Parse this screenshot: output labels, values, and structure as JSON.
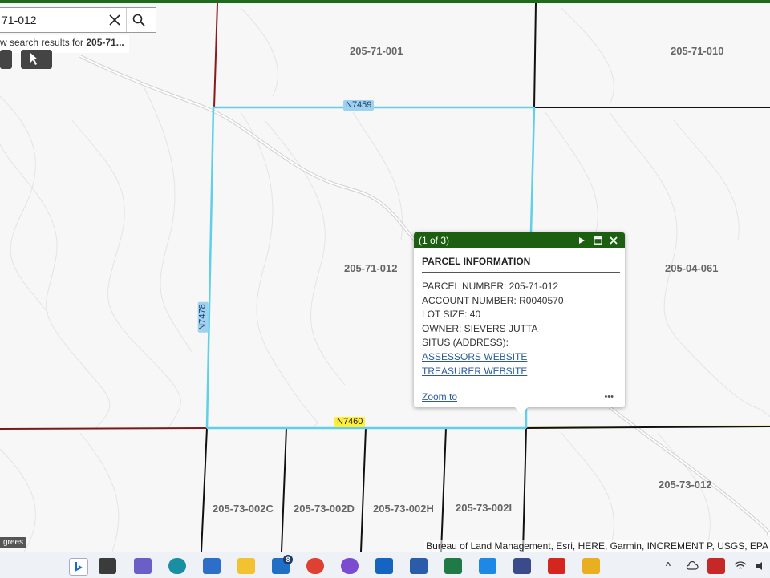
{
  "search": {
    "value": "71-012",
    "hint_prefix": "w search results for ",
    "hint_term": "205-71..."
  },
  "map": {
    "parcels": [
      "205-71-001",
      "205-71-010",
      "205-71-012",
      "205-04-061",
      "205-73-002C",
      "205-73-002D",
      "205-73-002H",
      "205-73-002I",
      "205-73-012"
    ],
    "roads": [
      "N7459",
      "N7478",
      "N7460"
    ],
    "scalebar": "grees",
    "attribution": "Bureau of Land Management, Esri, HERE, Garmin, INCREMENT P, USGS, EPA"
  },
  "popup": {
    "count": "(1 of 3)",
    "title": "PARCEL INFORMATION",
    "parcel_number": "PARCEL NUMBER: 205-71-012",
    "account_number": "ACCOUNT NUMBER: R0040570",
    "lot_size": "LOT SIZE: 40",
    "owner": "OWNER: SIEVERS JUTTA",
    "situs": "SITUS (ADDRESS):",
    "assessors_link": "ASSESSORS WEBSITE",
    "treasurer_link": "TREASURER WEBSITE",
    "zoom_link": "Zoom to",
    "more": "•••"
  },
  "colors": {
    "header_green": "#1c5f10",
    "parcel_selected": "#5fd0e8",
    "parcel_line": "#111111",
    "red_boundary": "#8b1a1a"
  },
  "taskbar": {
    "mail_badge": "8",
    "icons": [
      "bing-icon",
      "file-explorer-icon",
      "teams-icon",
      "edge-icon",
      "store-icon",
      "folder-icon",
      "mail-icon",
      "chrome-icon",
      "copilot-icon",
      "outlook-icon",
      "word-icon",
      "excel-icon",
      "office-icon",
      "dropbox-icon",
      "app-icon",
      "acrobat-icon",
      "snip-icon"
    ]
  }
}
